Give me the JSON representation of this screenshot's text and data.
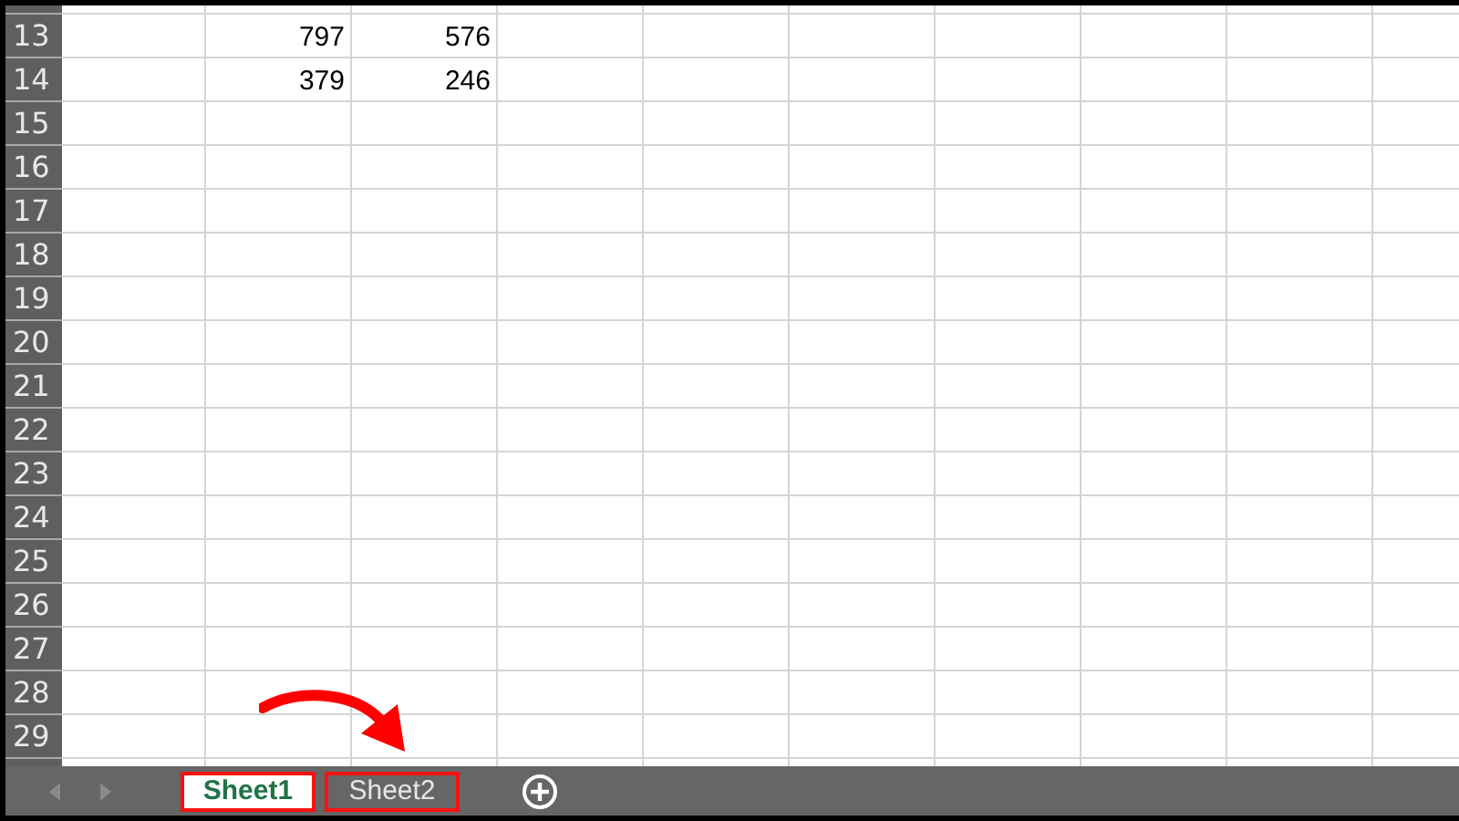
{
  "sheet": {
    "rows": [
      {
        "number": "13",
        "column_2": "797",
        "column_3": "576"
      },
      {
        "number": "14",
        "column_2": "379",
        "column_3": "246"
      },
      {
        "number": "15"
      },
      {
        "number": "16"
      },
      {
        "number": "17"
      },
      {
        "number": "18"
      },
      {
        "number": "19"
      },
      {
        "number": "20"
      },
      {
        "number": "21"
      },
      {
        "number": "22"
      },
      {
        "number": "23"
      },
      {
        "number": "24"
      },
      {
        "number": "25"
      },
      {
        "number": "26"
      },
      {
        "number": "27"
      },
      {
        "number": "28"
      },
      {
        "number": "29"
      }
    ]
  },
  "sheet_tabs": [
    {
      "label": "Sheet1",
      "selected": true,
      "highlighted": true
    },
    {
      "label": "Sheet2",
      "selected": false,
      "highlighted": true
    }
  ]
}
